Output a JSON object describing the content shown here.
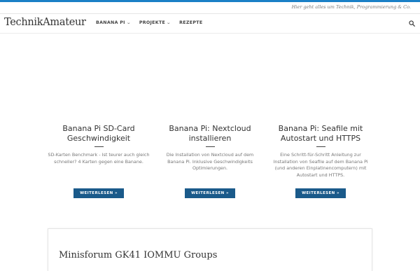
{
  "topbar": {
    "tagline": "Hier geht alles um Technik, Programmierung & Co."
  },
  "header": {
    "site_title": "TechnikAmateur",
    "nav": [
      {
        "label": "BANANA PI",
        "has_dropdown": true
      },
      {
        "label": "PROJEKTE",
        "has_dropdown": true
      },
      {
        "label": "REZEPTE",
        "has_dropdown": false
      }
    ],
    "search_icon": "search-icon"
  },
  "cards": [
    {
      "title": "Banana Pi SD-Card Geschwindigkeit",
      "excerpt": "SD-Karten Benchmark - Ist teurer auch gleich schneller? 4 Karten gegen eine Banane.",
      "button": "WEITERLESEN »"
    },
    {
      "title": "Banana Pi: Nextcloud installieren",
      "excerpt": "Die Installation von Nextcloud auf dem Banana Pi. Inklusive Geschwindigkeits Optimierungen.",
      "button": "WEITERLESEN »"
    },
    {
      "title": "Banana Pi: Seafile mit Autostart und HTTPS",
      "excerpt": "Eine Schritt-für-Schritt Anleitung zur Installation von Seafile auf dem Banana Pi (und anderen Einplatinencomputern) mit Autostart und HTTPS.",
      "button": "WEITERLESEN »"
    }
  ],
  "post": {
    "title": "Minisforum GK41 IOMMU Groups"
  },
  "colors": {
    "accent": "#1b80c6",
    "button": "#1a5a8a"
  }
}
